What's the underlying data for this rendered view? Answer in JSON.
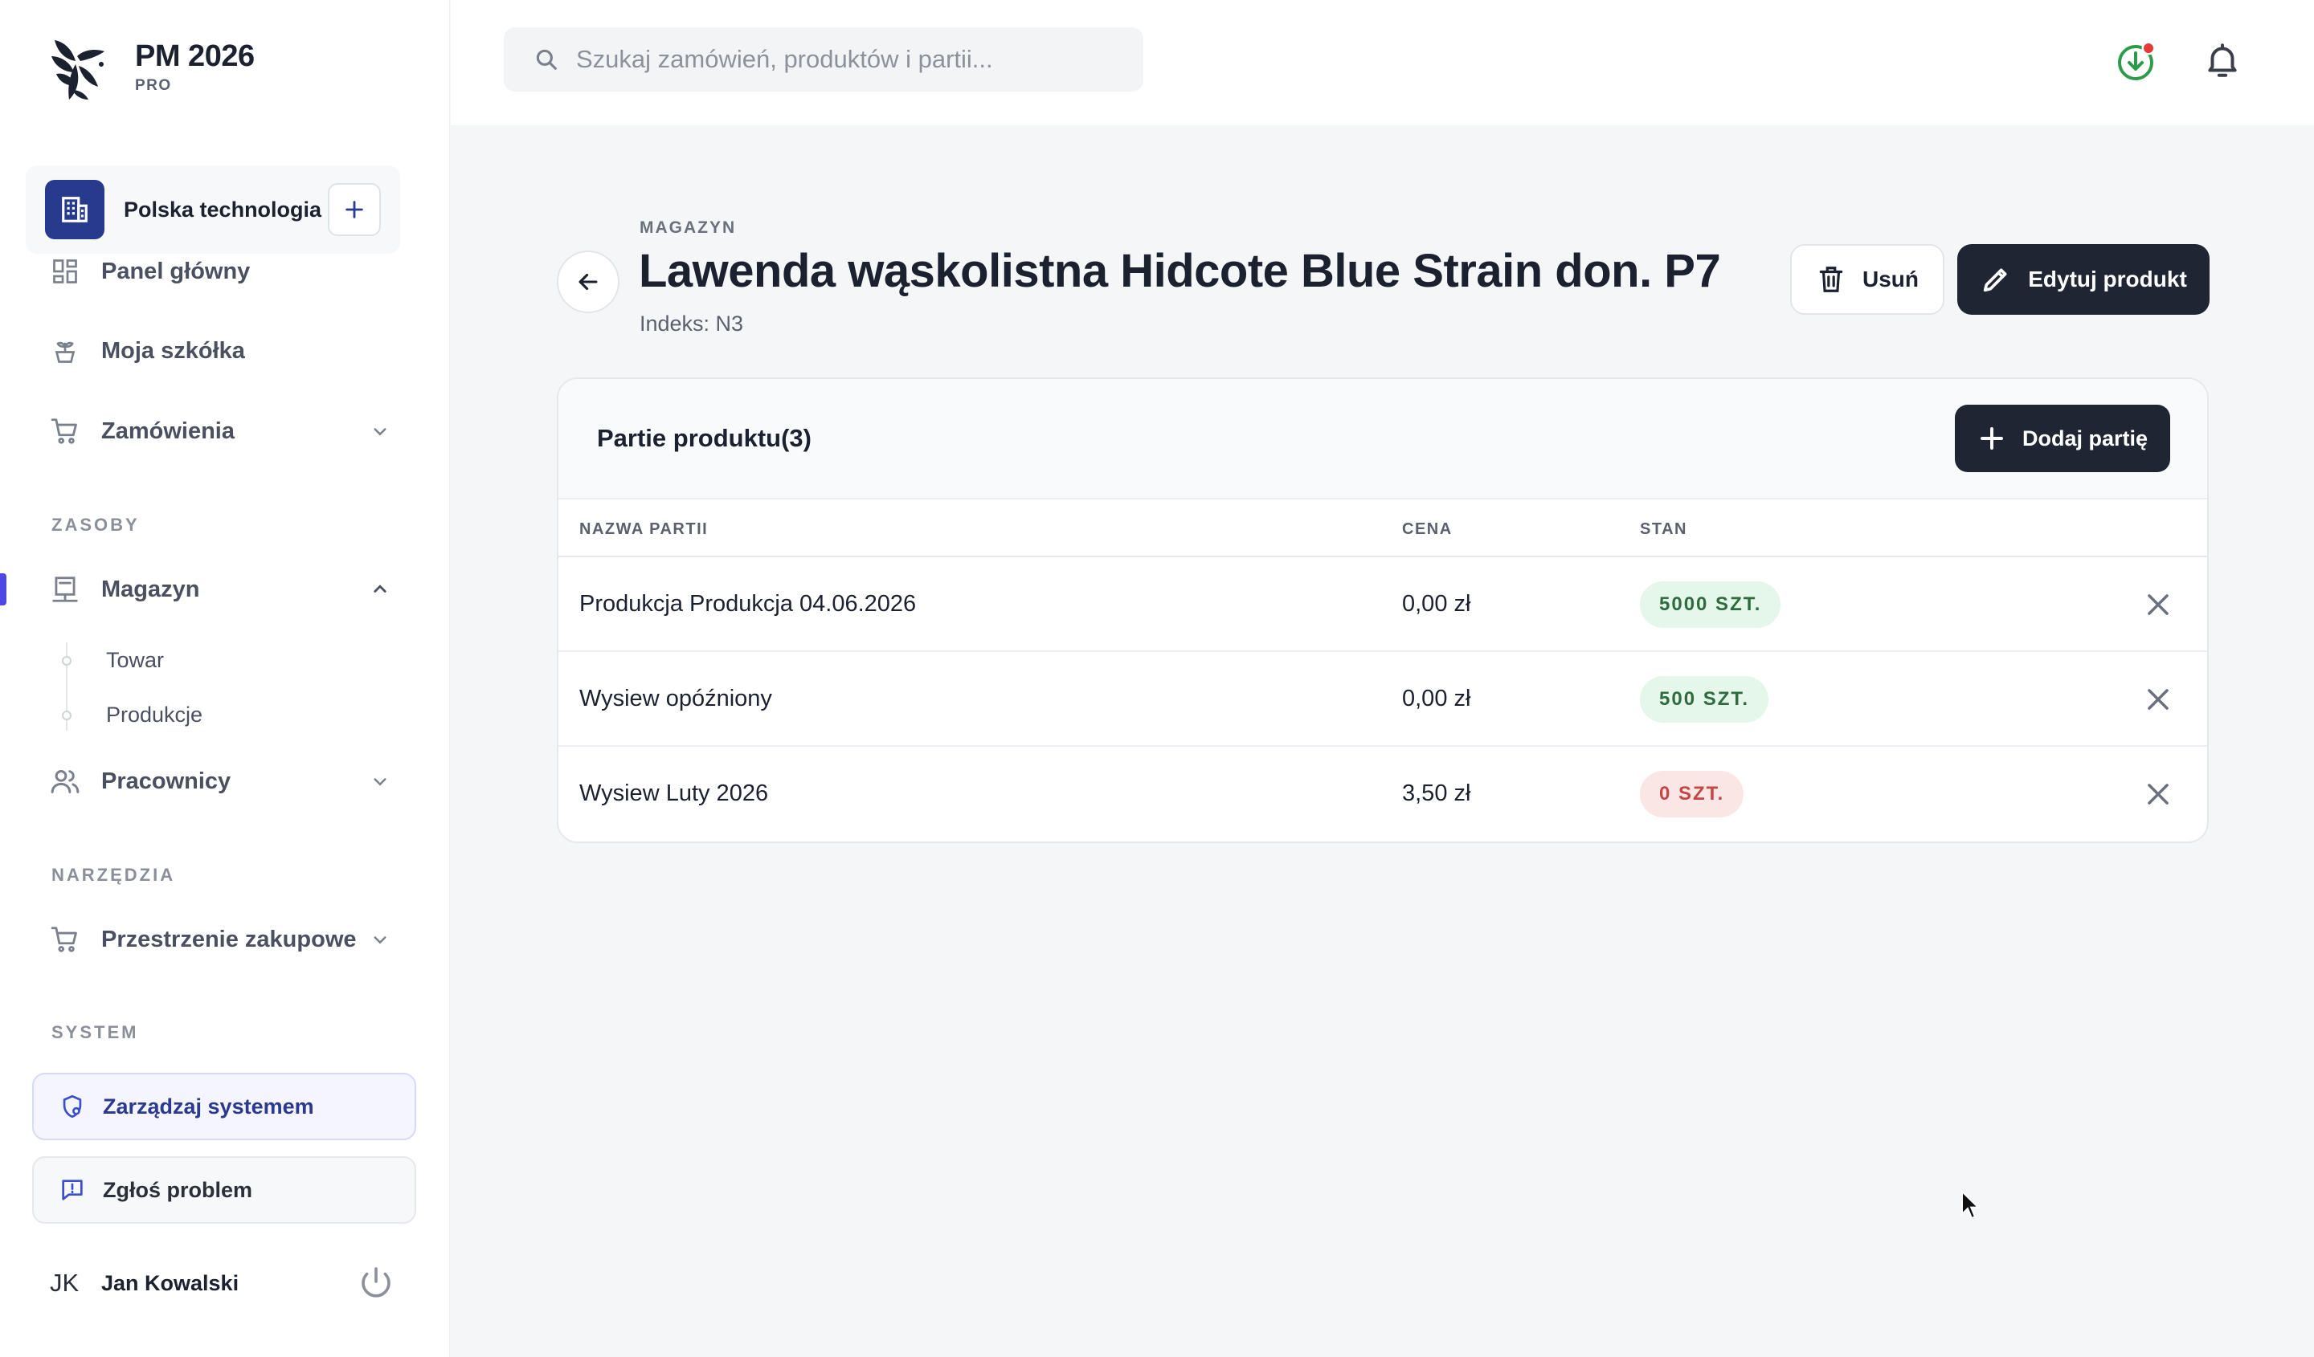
{
  "brand": {
    "name": "PM 2026",
    "tier": "PRO"
  },
  "org": {
    "name": "Polska technologia",
    "add_label": "+"
  },
  "nav": {
    "dashboard": "Panel główny",
    "nursery": "Moja szkółka",
    "orders": "Zamówienia",
    "section_resources": "ZASOBY",
    "warehouse": "Magazyn",
    "warehouse_sub": [
      "Towar",
      "Produkcje"
    ],
    "employees": "Pracownicy",
    "section_tools": "NARZĘDZIA",
    "purchase_spaces": "Przestrzenie zakupowe",
    "section_system": "SYSTEM"
  },
  "system": {
    "manage": "Zarządzaj systemem",
    "report": "Zgłoś problem"
  },
  "user": {
    "initials": "JK",
    "name": "Jan Kowalski"
  },
  "search": {
    "placeholder": "Szukaj zamówień, produktów i partii...",
    "value": ""
  },
  "page": {
    "eyebrow": "MAGAZYN",
    "title": "Lawenda wąskolistna Hidcote Blue Strain don. P7",
    "index": "Indeks: N3",
    "delete_label": "Usuń",
    "edit_label": "Edytuj produkt"
  },
  "batches": {
    "title": "Partie produktu(3)",
    "add_label": "Dodaj partię",
    "columns": {
      "name": "NAZWA PARTII",
      "price": "CENA",
      "stock": "STAN"
    },
    "rows": [
      {
        "name": "Produkcja Produkcja 04.06.2026",
        "price": "0,00 zł",
        "stock": "5000 SZT.",
        "status": "ok"
      },
      {
        "name": "Wysiew opóźniony",
        "price": "0,00 zł",
        "stock": "500 SZT.",
        "status": "ok"
      },
      {
        "name": "Wysiew Luty 2026",
        "price": "3,50 zł",
        "stock": "0 SZT.",
        "status": "zero"
      }
    ]
  },
  "colors": {
    "accent": "#4f46e5",
    "primary_button": "#1f2533",
    "org_icon": "#283a8e",
    "stock_ok_bg": "#e5f6ea",
    "stock_zero_bg": "#fbe6e6",
    "notification_dot": "#e53935",
    "sync_icon": "#2e9b4a"
  },
  "icons": {
    "search": "search-icon",
    "sync": "download-sync-icon",
    "bell": "bell-icon",
    "back": "arrow-left-icon",
    "delete": "trash-icon",
    "edit": "pencil-icon",
    "add": "plus-icon",
    "remove_row": "close-icon"
  }
}
